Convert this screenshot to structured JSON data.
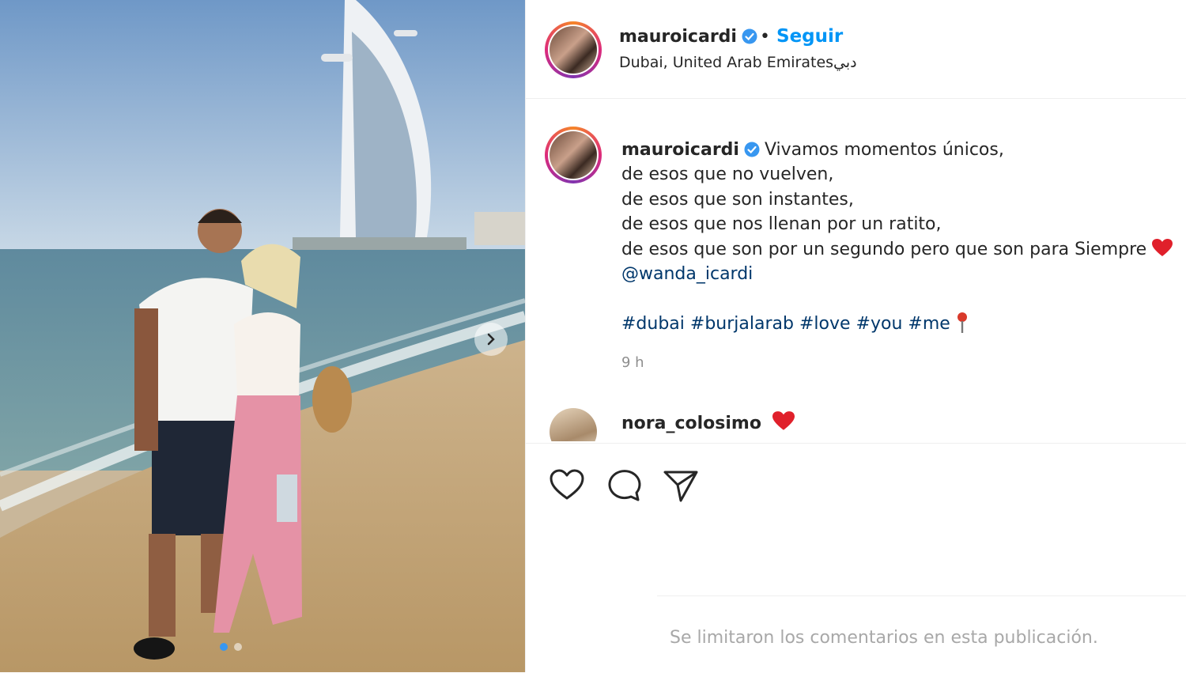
{
  "post": {
    "username": "mauroicardi",
    "follow_label": "Seguir",
    "separator": "•",
    "location": "Dubai, United Arab Emiratesدبي"
  },
  "caption": {
    "username": "mauroicardi",
    "line1": "Vivamos momentos únicos,",
    "line2": "de esos que no vuelven,",
    "line3": "de esos que son instantes,",
    "line4": "de esos que nos llenan por un ratito,",
    "line5": "de esos que son por un segundo pero que son para Siempre",
    "mention": "@wanda_icardi",
    "hashtags": [
      "#dubai",
      "#burjalarab",
      "#love",
      "#you",
      "#me"
    ],
    "time": "9 h"
  },
  "comments": [
    {
      "username": "nora_colosimo"
    }
  ],
  "icons": {
    "heart_emoji": "heart-emoji-icon",
    "pin_emoji": "round-pushpin-icon",
    "like": "heart-outline-icon",
    "comment": "comment-bubble-icon",
    "share": "paper-plane-icon",
    "verified": "verified-badge-icon",
    "next": "chevron-right-icon"
  },
  "footer": {
    "limited_comments": "Se limitaron los comentarios en esta publicación."
  },
  "carousel": {
    "total_slides": 2,
    "current_slide": 1
  },
  "colors": {
    "link": "#0095f6",
    "verified": "#3897f0",
    "text": "#262626",
    "muted": "#8e8e8e",
    "tag": "#00376b",
    "heart": "#ed4956"
  }
}
